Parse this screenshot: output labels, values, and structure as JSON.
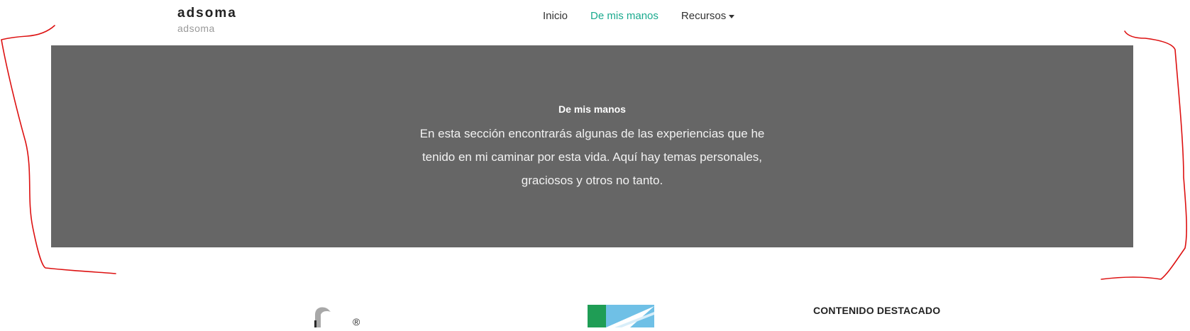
{
  "brand": {
    "title": "adsoma",
    "subtitle": "adsoma"
  },
  "nav": {
    "items": [
      {
        "label": "Inicio",
        "active": false
      },
      {
        "label": "De mis manos",
        "active": true
      },
      {
        "label": "Recursos",
        "active": false,
        "has_dropdown": true
      }
    ]
  },
  "hero": {
    "title": "De mis manos",
    "text": "En esta sección encontrarás algunas de las experiencias que he tenido en mi caminar por esta vida. Aquí hay temas personales, graciosos y otros no tanto."
  },
  "footer_strip": {
    "registered_mark": "®",
    "featured_heading": "CONTENIDO DESTACADO"
  },
  "colors": {
    "accent": "#1aaa8e",
    "hero_bg": "#666666",
    "annotation": "#dd1111"
  }
}
